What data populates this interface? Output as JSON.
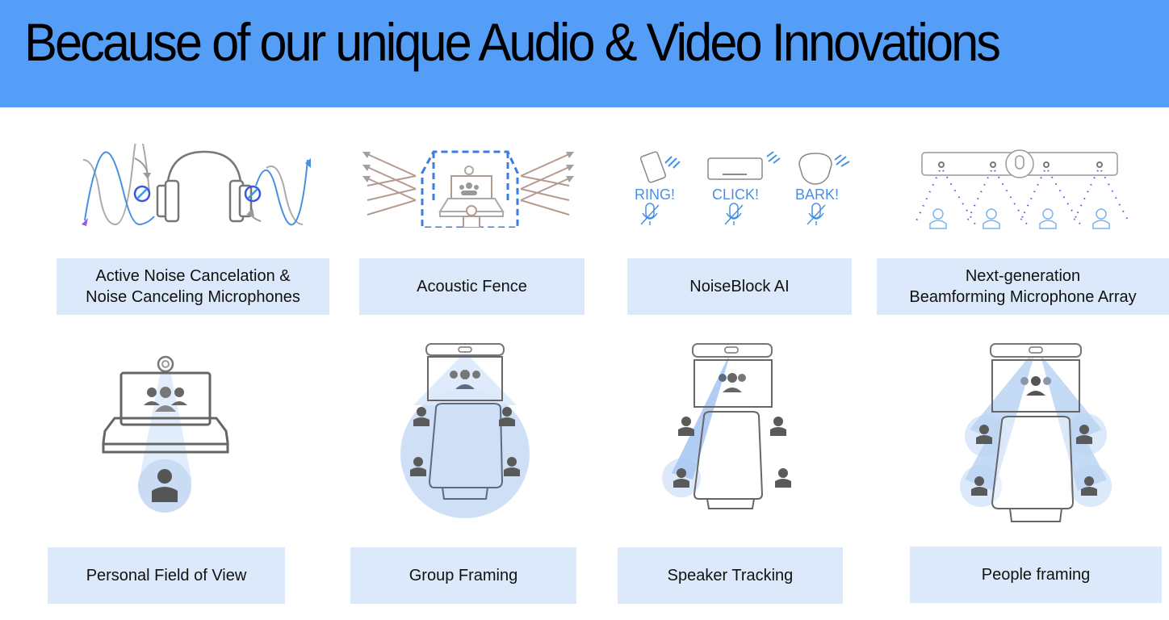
{
  "header": {
    "title": "Because of our unique Audio & Video Innovations"
  },
  "colors": {
    "header_bg": "#559ef7",
    "label_bg": "#dbe9fa",
    "accent_blue": "#4a90e2",
    "icon_gray": "#666666"
  },
  "features": [
    {
      "id": "anc",
      "label_lines": [
        "Active Noise Cancelation &",
        "Noise Canceling Microphones"
      ],
      "icon": "headphones-noise-cancel-icon"
    },
    {
      "id": "acoustic-fence",
      "label_lines": [
        "Acoustic Fence"
      ],
      "icon": "acoustic-fence-icon"
    },
    {
      "id": "noiseblock",
      "label_lines": [
        "NoiseBlock AI"
      ],
      "icon": "noiseblock-icon",
      "sound_words": [
        "RING!",
        "CLICK!",
        "BARK!"
      ]
    },
    {
      "id": "beamforming",
      "label_lines": [
        "Next-generation",
        "Beamforming Microphone Array"
      ],
      "icon": "beamforming-mic-array-icon"
    },
    {
      "id": "personal-fov",
      "label_lines": [
        "Personal Field of View"
      ],
      "icon": "personal-field-of-view-icon"
    },
    {
      "id": "group-framing",
      "label_lines": [
        "Group Framing"
      ],
      "icon": "group-framing-icon"
    },
    {
      "id": "speaker-tracking",
      "label_lines": [
        "Speaker Tracking"
      ],
      "icon": "speaker-tracking-icon"
    },
    {
      "id": "people-framing",
      "label_lines": [
        "People framing"
      ],
      "icon": "people-framing-icon"
    }
  ]
}
